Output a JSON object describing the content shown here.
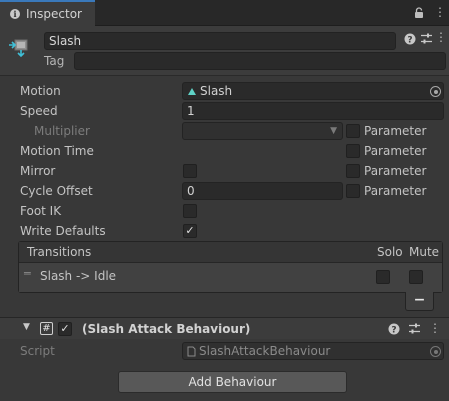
{
  "tab": {
    "title": "Inspector"
  },
  "header": {
    "name": "Slash",
    "tag_label": "Tag",
    "tag_value": ""
  },
  "properties": {
    "motion_label": "Motion",
    "motion_value": "Slash",
    "speed_label": "Speed",
    "speed_value": "1",
    "multiplier_label": "Multiplier",
    "multiplier_value": "",
    "motion_time_label": "Motion Time",
    "mirror_label": "Mirror",
    "cycle_offset_label": "Cycle Offset",
    "cycle_offset_value": "0",
    "foot_ik_label": "Foot IK",
    "write_defaults_label": "Write Defaults",
    "write_defaults_checked": true,
    "parameter_label": "Parameter"
  },
  "transitions": {
    "header": "Transitions",
    "solo_label": "Solo",
    "mute_label": "Mute",
    "items": [
      {
        "name": "Slash -> Idle",
        "solo": false,
        "mute": false
      }
    ],
    "remove_label": "−"
  },
  "behaviour": {
    "title": "(Slash Attack Behaviour)",
    "enabled": true,
    "script_label": "Script",
    "script_value": "SlashAttackBehaviour"
  },
  "add_button_label": "Add Behaviour",
  "colors": {
    "accent": "#3a79bb",
    "background": "#383838",
    "field": "#2a2a2a"
  },
  "icons": [
    "info-icon",
    "lock-icon",
    "menu-icon",
    "state-icon",
    "help-icon",
    "settings-icon",
    "object-picker-icon",
    "script-icon"
  ]
}
